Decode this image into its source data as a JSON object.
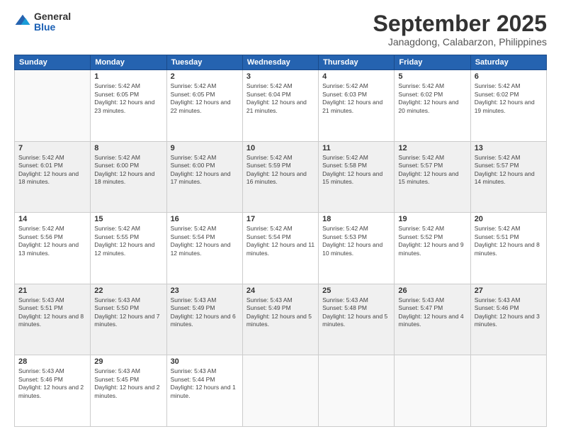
{
  "logo": {
    "general": "General",
    "blue": "Blue"
  },
  "header": {
    "month": "September 2025",
    "location": "Janagdong, Calabarzon, Philippines"
  },
  "weekdays": [
    "Sunday",
    "Monday",
    "Tuesday",
    "Wednesday",
    "Thursday",
    "Friday",
    "Saturday"
  ],
  "days": [
    {
      "date": "",
      "sunrise": "",
      "sunset": "",
      "daylight": ""
    },
    {
      "date": "1",
      "sunrise": "Sunrise: 5:42 AM",
      "sunset": "Sunset: 6:05 PM",
      "daylight": "Daylight: 12 hours and 23 minutes."
    },
    {
      "date": "2",
      "sunrise": "Sunrise: 5:42 AM",
      "sunset": "Sunset: 6:05 PM",
      "daylight": "Daylight: 12 hours and 22 minutes."
    },
    {
      "date": "3",
      "sunrise": "Sunrise: 5:42 AM",
      "sunset": "Sunset: 6:04 PM",
      "daylight": "Daylight: 12 hours and 21 minutes."
    },
    {
      "date": "4",
      "sunrise": "Sunrise: 5:42 AM",
      "sunset": "Sunset: 6:03 PM",
      "daylight": "Daylight: 12 hours and 21 minutes."
    },
    {
      "date": "5",
      "sunrise": "Sunrise: 5:42 AM",
      "sunset": "Sunset: 6:02 PM",
      "daylight": "Daylight: 12 hours and 20 minutes."
    },
    {
      "date": "6",
      "sunrise": "Sunrise: 5:42 AM",
      "sunset": "Sunset: 6:02 PM",
      "daylight": "Daylight: 12 hours and 19 minutes."
    },
    {
      "date": "7",
      "sunrise": "Sunrise: 5:42 AM",
      "sunset": "Sunset: 6:01 PM",
      "daylight": "Daylight: 12 hours and 18 minutes."
    },
    {
      "date": "8",
      "sunrise": "Sunrise: 5:42 AM",
      "sunset": "Sunset: 6:00 PM",
      "daylight": "Daylight: 12 hours and 18 minutes."
    },
    {
      "date": "9",
      "sunrise": "Sunrise: 5:42 AM",
      "sunset": "Sunset: 6:00 PM",
      "daylight": "Daylight: 12 hours and 17 minutes."
    },
    {
      "date": "10",
      "sunrise": "Sunrise: 5:42 AM",
      "sunset": "Sunset: 5:59 PM",
      "daylight": "Daylight: 12 hours and 16 minutes."
    },
    {
      "date": "11",
      "sunrise": "Sunrise: 5:42 AM",
      "sunset": "Sunset: 5:58 PM",
      "daylight": "Daylight: 12 hours and 15 minutes."
    },
    {
      "date": "12",
      "sunrise": "Sunrise: 5:42 AM",
      "sunset": "Sunset: 5:57 PM",
      "daylight": "Daylight: 12 hours and 15 minutes."
    },
    {
      "date": "13",
      "sunrise": "Sunrise: 5:42 AM",
      "sunset": "Sunset: 5:57 PM",
      "daylight": "Daylight: 12 hours and 14 minutes."
    },
    {
      "date": "14",
      "sunrise": "Sunrise: 5:42 AM",
      "sunset": "Sunset: 5:56 PM",
      "daylight": "Daylight: 12 hours and 13 minutes."
    },
    {
      "date": "15",
      "sunrise": "Sunrise: 5:42 AM",
      "sunset": "Sunset: 5:55 PM",
      "daylight": "Daylight: 12 hours and 12 minutes."
    },
    {
      "date": "16",
      "sunrise": "Sunrise: 5:42 AM",
      "sunset": "Sunset: 5:54 PM",
      "daylight": "Daylight: 12 hours and 12 minutes."
    },
    {
      "date": "17",
      "sunrise": "Sunrise: 5:42 AM",
      "sunset": "Sunset: 5:54 PM",
      "daylight": "Daylight: 12 hours and 11 minutes."
    },
    {
      "date": "18",
      "sunrise": "Sunrise: 5:42 AM",
      "sunset": "Sunset: 5:53 PM",
      "daylight": "Daylight: 12 hours and 10 minutes."
    },
    {
      "date": "19",
      "sunrise": "Sunrise: 5:42 AM",
      "sunset": "Sunset: 5:52 PM",
      "daylight": "Daylight: 12 hours and 9 minutes."
    },
    {
      "date": "20",
      "sunrise": "Sunrise: 5:42 AM",
      "sunset": "Sunset: 5:51 PM",
      "daylight": "Daylight: 12 hours and 8 minutes."
    },
    {
      "date": "21",
      "sunrise": "Sunrise: 5:43 AM",
      "sunset": "Sunset: 5:51 PM",
      "daylight": "Daylight: 12 hours and 8 minutes."
    },
    {
      "date": "22",
      "sunrise": "Sunrise: 5:43 AM",
      "sunset": "Sunset: 5:50 PM",
      "daylight": "Daylight: 12 hours and 7 minutes."
    },
    {
      "date": "23",
      "sunrise": "Sunrise: 5:43 AM",
      "sunset": "Sunset: 5:49 PM",
      "daylight": "Daylight: 12 hours and 6 minutes."
    },
    {
      "date": "24",
      "sunrise": "Sunrise: 5:43 AM",
      "sunset": "Sunset: 5:49 PM",
      "daylight": "Daylight: 12 hours and 5 minutes."
    },
    {
      "date": "25",
      "sunrise": "Sunrise: 5:43 AM",
      "sunset": "Sunset: 5:48 PM",
      "daylight": "Daylight: 12 hours and 5 minutes."
    },
    {
      "date": "26",
      "sunrise": "Sunrise: 5:43 AM",
      "sunset": "Sunset: 5:47 PM",
      "daylight": "Daylight: 12 hours and 4 minutes."
    },
    {
      "date": "27",
      "sunrise": "Sunrise: 5:43 AM",
      "sunset": "Sunset: 5:46 PM",
      "daylight": "Daylight: 12 hours and 3 minutes."
    },
    {
      "date": "28",
      "sunrise": "Sunrise: 5:43 AM",
      "sunset": "Sunset: 5:46 PM",
      "daylight": "Daylight: 12 hours and 2 minutes."
    },
    {
      "date": "29",
      "sunrise": "Sunrise: 5:43 AM",
      "sunset": "Sunset: 5:45 PM",
      "daylight": "Daylight: 12 hours and 2 minutes."
    },
    {
      "date": "30",
      "sunrise": "Sunrise: 5:43 AM",
      "sunset": "Sunset: 5:44 PM",
      "daylight": "Daylight: 12 hours and 1 minute."
    }
  ]
}
